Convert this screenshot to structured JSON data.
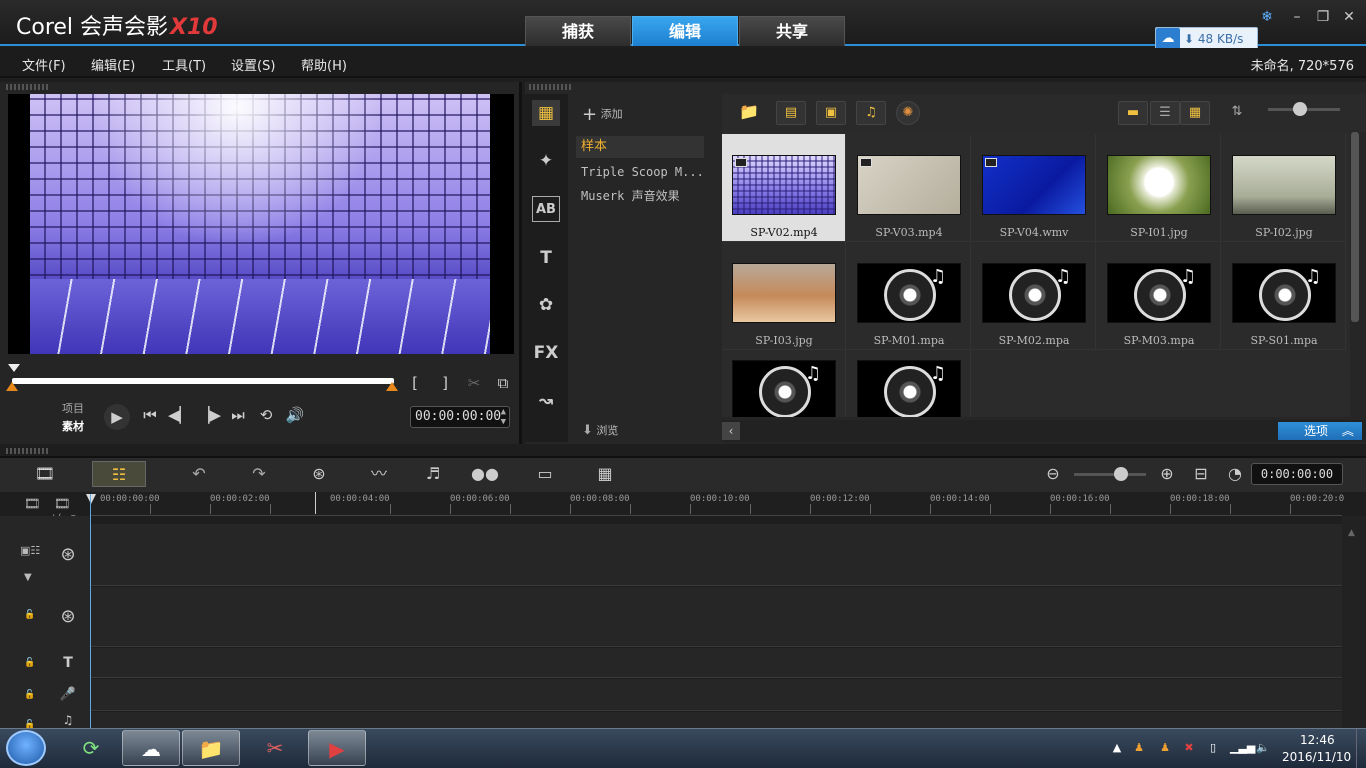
{
  "app": {
    "brand": "Corel 会声会影",
    "version": "X10",
    "tabs": [
      {
        "label": "捕获",
        "active": false
      },
      {
        "label": "编辑",
        "active": true
      },
      {
        "label": "共享",
        "active": false
      }
    ],
    "network_speed": "48 KB/s"
  },
  "menu": [
    "文件(F)",
    "编辑(E)",
    "工具(T)",
    "设置(S)",
    "帮助(H)"
  ],
  "project_info": "未命名, 720*576",
  "preview": {
    "mode_project": "项目",
    "mode_clip": "素材",
    "timecode": "00:00:00:00"
  },
  "library": {
    "add_label": "添加",
    "browse_label": "浏览",
    "folders": [
      "样本",
      "Triple Scoop M...",
      "Muserk 声音效果"
    ],
    "selected_folder": 0,
    "items": [
      {
        "name": "SP-V02.mp4",
        "kind": "video",
        "selected": true
      },
      {
        "name": "SP-V03.mp4",
        "kind": "video"
      },
      {
        "name": "SP-V04.wmv",
        "kind": "video"
      },
      {
        "name": "SP-I01.jpg",
        "kind": "image"
      },
      {
        "name": "SP-I02.jpg",
        "kind": "image"
      },
      {
        "name": "SP-I03.jpg",
        "kind": "image"
      },
      {
        "name": "SP-M01.mpa",
        "kind": "audio"
      },
      {
        "name": "SP-M02.mpa",
        "kind": "audio"
      },
      {
        "name": "SP-M03.mpa",
        "kind": "audio"
      },
      {
        "name": "SP-S01.mpa",
        "kind": "audio"
      },
      {
        "name": "",
        "kind": "audio"
      },
      {
        "name": "",
        "kind": "audio"
      }
    ],
    "options_label": "选项"
  },
  "timeline": {
    "timecode": "0:00:00:00",
    "ruler": [
      "00:00:00:00",
      "00:00:02:00",
      "00:00:04:00",
      "00:00:06:00",
      "00:00:08:00",
      "00:00:10:00",
      "00:00:12:00",
      "00:00:14:00",
      "00:00:16:00",
      "00:00:18:00",
      "00:00:20:0"
    ]
  },
  "taskbar": {
    "time": "12:46",
    "date": "2016/11/10"
  }
}
